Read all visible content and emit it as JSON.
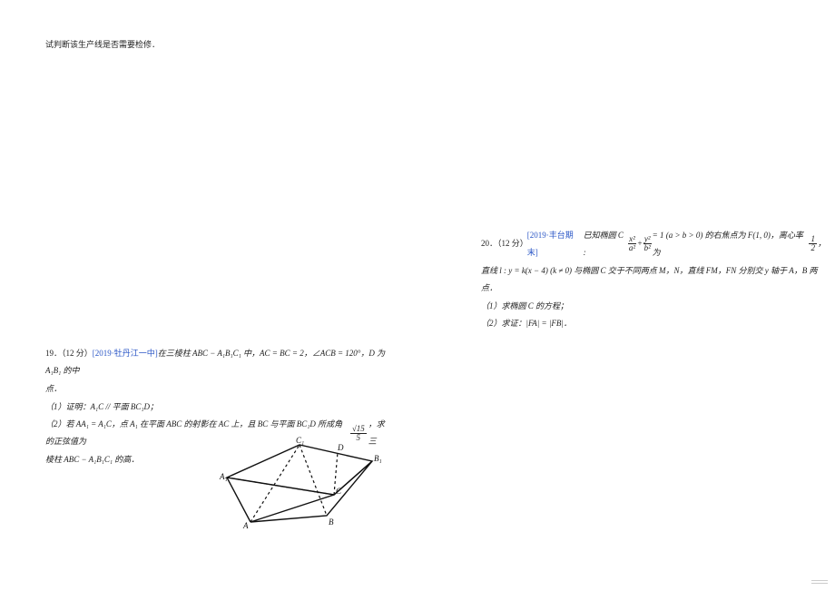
{
  "left": {
    "top_line": "试判断该生产线是否需要检修．",
    "q19": {
      "number_points": "19．（12 分）",
      "source": "[2019·牡丹江一中]",
      "stem1": "在三棱柱 ABC − A₁B₁C₁ 中，AC = BC = 2，∠ACB = 120°，D 为 A₁B₁ 的中",
      "stem2": "点．",
      "part1": "（1）证明：A₁C // 平面 BC₁D；",
      "part2a": "（2）若 AA₁ = A₁C，点 A₁ 在平面 ABC 的射影在 AC 上，且 BC 与平面 BC₁D 所成角的正弦值为",
      "part2_frac_top": "√15",
      "part2_frac_bot": "5",
      "part2b": "，求三",
      "part2c": "棱柱 ABC − A₁B₁C₁ 的高．"
    },
    "figure_labels": {
      "A1": "A₁",
      "C1": "C₁",
      "B1": "B₁",
      "D": "D",
      "A": "A",
      "B": "B",
      "C": "C"
    }
  },
  "right": {
    "q20": {
      "number_points": "20．（12 分）",
      "source": "[2019·丰台期末]",
      "stem1a": "已知椭圆 C : ",
      "stem1_frac1_top": "x²",
      "stem1_frac1_bot": "a²",
      "stem1_plus": " + ",
      "stem1_frac2_top": "y²",
      "stem1_frac2_bot": "b²",
      "stem1b": " = 1 (a > b > 0) 的右焦点为 F(1, 0)，离心率为 ",
      "stem1_frac3_top": "1",
      "stem1_frac3_bot": "2",
      "stem1c": "，",
      "stem2": "直线 l : y = k(x − 4) (k ≠ 0) 与椭圆 C 交于不同两点 M，N，直线 FM，FN 分别交 y 轴于 A，B 两点．",
      "part1": "（1）求椭圆 C 的方程；",
      "part2": "（2）求证：|FA| = |FB|．"
    }
  }
}
